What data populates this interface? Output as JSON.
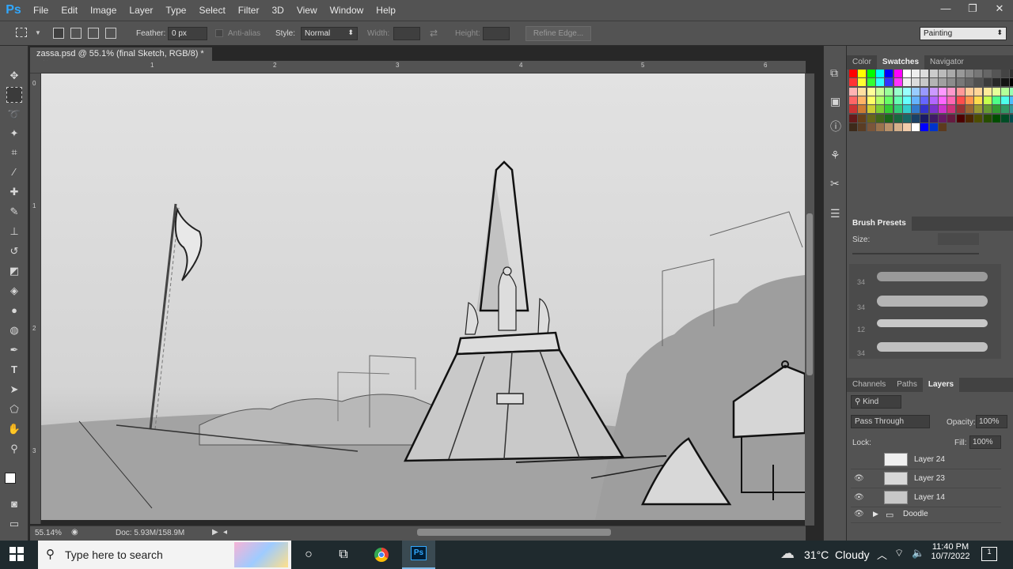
{
  "app": {
    "logo": "Ps",
    "accent": "#31a8ff"
  },
  "menu": [
    "File",
    "Edit",
    "Image",
    "Layer",
    "Type",
    "Select",
    "Filter",
    "3D",
    "View",
    "Window",
    "Help"
  ],
  "window_controls": [
    "—",
    "❐",
    "✕"
  ],
  "options": {
    "feather_label": "Feather:",
    "feather_value": "0 px",
    "antialias_label": "Anti-alias",
    "style_label": "Style:",
    "style_value": "Normal",
    "width_label": "Width:",
    "height_label": "Height:",
    "refine_edge": "Refine Edge...",
    "workspace": "Painting"
  },
  "document": {
    "tab_title": "zassa.psd @ 55.1% (final Sketch, RGB/8) *",
    "ruler_top": [
      "1",
      "2",
      "3",
      "4",
      "5",
      "6"
    ],
    "ruler_left": [
      "0",
      "1",
      "2",
      "3"
    ],
    "zoom": "55.14%",
    "doc_size": "Doc: 5.93M/158.9M"
  },
  "panels": {
    "color_tabs": [
      "Color",
      "Swatches",
      "Navigator"
    ],
    "active_color_tab": "Swatches",
    "brush_presets": {
      "title": "Brush Presets",
      "size_label": "Size:",
      "sizes": [
        "34",
        "34",
        "12",
        "34"
      ]
    },
    "layer_tabs": [
      "Channels",
      "Paths",
      "Layers"
    ],
    "active_layer_tab": "Layers",
    "kind_filter": "Kind",
    "blend_mode": "Pass Through",
    "opacity_label": "Opacity:",
    "opacity_value": "100%",
    "lock_label": "Lock:",
    "fill_label": "Fill:",
    "fill_value": "100%",
    "layers": [
      {
        "name": "Layer 24"
      },
      {
        "name": "Layer 23"
      },
      {
        "name": "Layer 14"
      },
      {
        "name": "Doodle",
        "group": true
      }
    ]
  },
  "taskbar": {
    "search_placeholder": "Type here to search",
    "weather": "31°C  Cloudy",
    "time": "11:40 PM",
    "date": "10/7/2022",
    "notification_count": "1"
  }
}
